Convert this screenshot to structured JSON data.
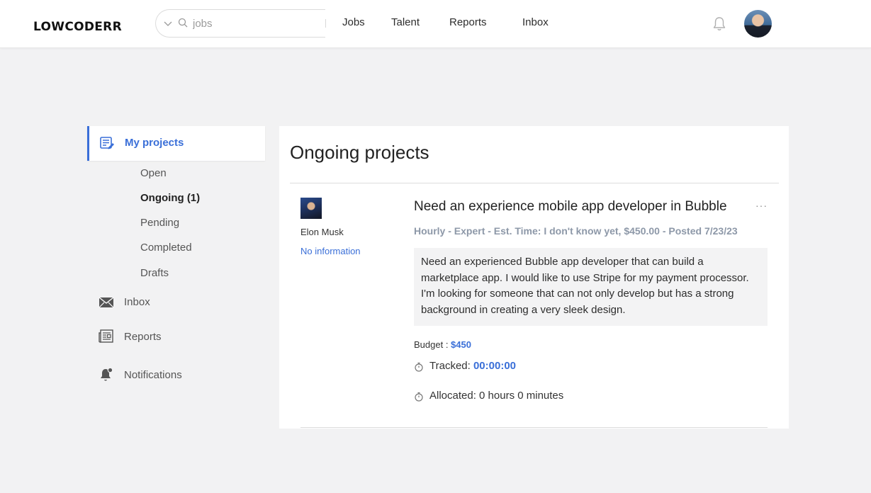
{
  "app": {
    "logo": "LOWCODERR"
  },
  "search": {
    "placeholder": "jobs",
    "value": ""
  },
  "nav": {
    "jobs": "Jobs",
    "talent": "Talent",
    "reports": "Reports",
    "inbox": "Inbox"
  },
  "sidebar": {
    "my_projects": "My projects",
    "sub_items": [
      "Open",
      "Ongoing (1)",
      "Pending",
      "Completed",
      "Drafts"
    ],
    "inbox": "Inbox",
    "reports": "Reports",
    "notifications": "Notifications"
  },
  "main": {
    "title": "Ongoing projects",
    "project": {
      "client_name": "Elon Musk",
      "client_info": "No information",
      "job_title": "Need an experience mobile app developer in Bubble",
      "meta": "Hourly - Expert - Est. Time: I don't know yet, $450.00 - Posted 7/23/23",
      "description": "Need an experienced Bubble app developer that can build a marketplace app. I would like to use Stripe for my payment processor. I'm looking for someone that can not only develop but has a strong background in creating a very sleek design.",
      "budget_label": "Budget : ",
      "budget_value": "$450",
      "tracked_label": "Tracked: ",
      "tracked_value": "00:00:00",
      "allocated": "Allocated: 0 hours 0 minutes",
      "more": "···"
    }
  },
  "colors": {
    "accent": "#3a6fd8",
    "background": "#f2f2f3",
    "meta": "#8d98a8"
  }
}
